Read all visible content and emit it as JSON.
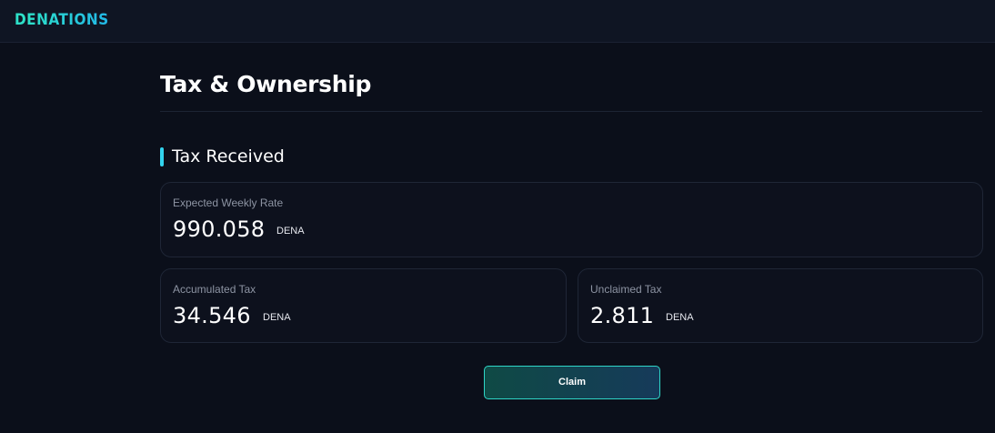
{
  "header": {
    "logo_first": "D",
    "logo_rest": "ENATIONS"
  },
  "page": {
    "title": "Tax & Ownership"
  },
  "section": {
    "title": "Tax Received"
  },
  "cards": {
    "weekly": {
      "label": "Expected Weekly Rate",
      "value": "990.058",
      "unit": "DENA"
    },
    "accumulated": {
      "label": "Accumulated Tax",
      "value": "34.546",
      "unit": "DENA"
    },
    "unclaimed": {
      "label": "Unclaimed Tax",
      "value": "2.811",
      "unit": "DENA"
    }
  },
  "actions": {
    "claim_label": "Claim"
  },
  "colors": {
    "accent": "#32d3ee",
    "brand": "#2de0c8",
    "background": "#0b0f1a"
  }
}
